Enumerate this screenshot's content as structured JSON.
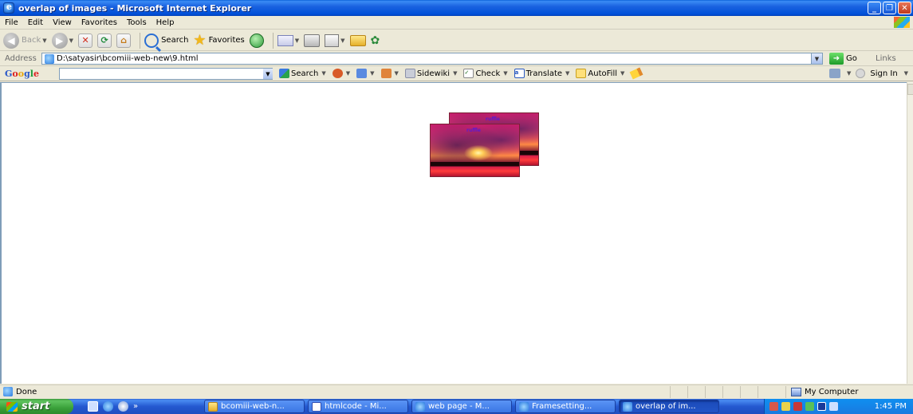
{
  "window": {
    "title": "overlap of images - Microsoft Internet Explorer",
    "buttons": [
      "minimize-button",
      "maximize-button",
      "close-button"
    ]
  },
  "menu": [
    "File",
    "Edit",
    "View",
    "Favorites",
    "Tools",
    "Help"
  ],
  "toolbar": {
    "back_label": "Back",
    "search_label": "Search",
    "favorites_label": "Favorites"
  },
  "address": {
    "label": "Address",
    "value": "D:\\satyasir\\bcomiii-web-new\\9.html",
    "go_label": "Go",
    "links_label": "Links"
  },
  "google": {
    "logo": "Google",
    "search_label": "Search",
    "sidewiki_label": "Sidewiki",
    "check_label": "Check",
    "translate_label": "Translate",
    "autofill_label": "AutoFill",
    "signin_label": "Sign In"
  },
  "content": {
    "caption_back": "ruffle",
    "caption_front": "ruffle"
  },
  "status": {
    "text": "Done",
    "zone": "My Computer"
  },
  "taskbar": {
    "start_label": "start",
    "tasks": [
      "bcomiii-web-n...",
      "htmlcode - Mi...",
      "web page - M...",
      "Framesetting...",
      "overlap of im..."
    ],
    "clock": "1:45 PM"
  }
}
